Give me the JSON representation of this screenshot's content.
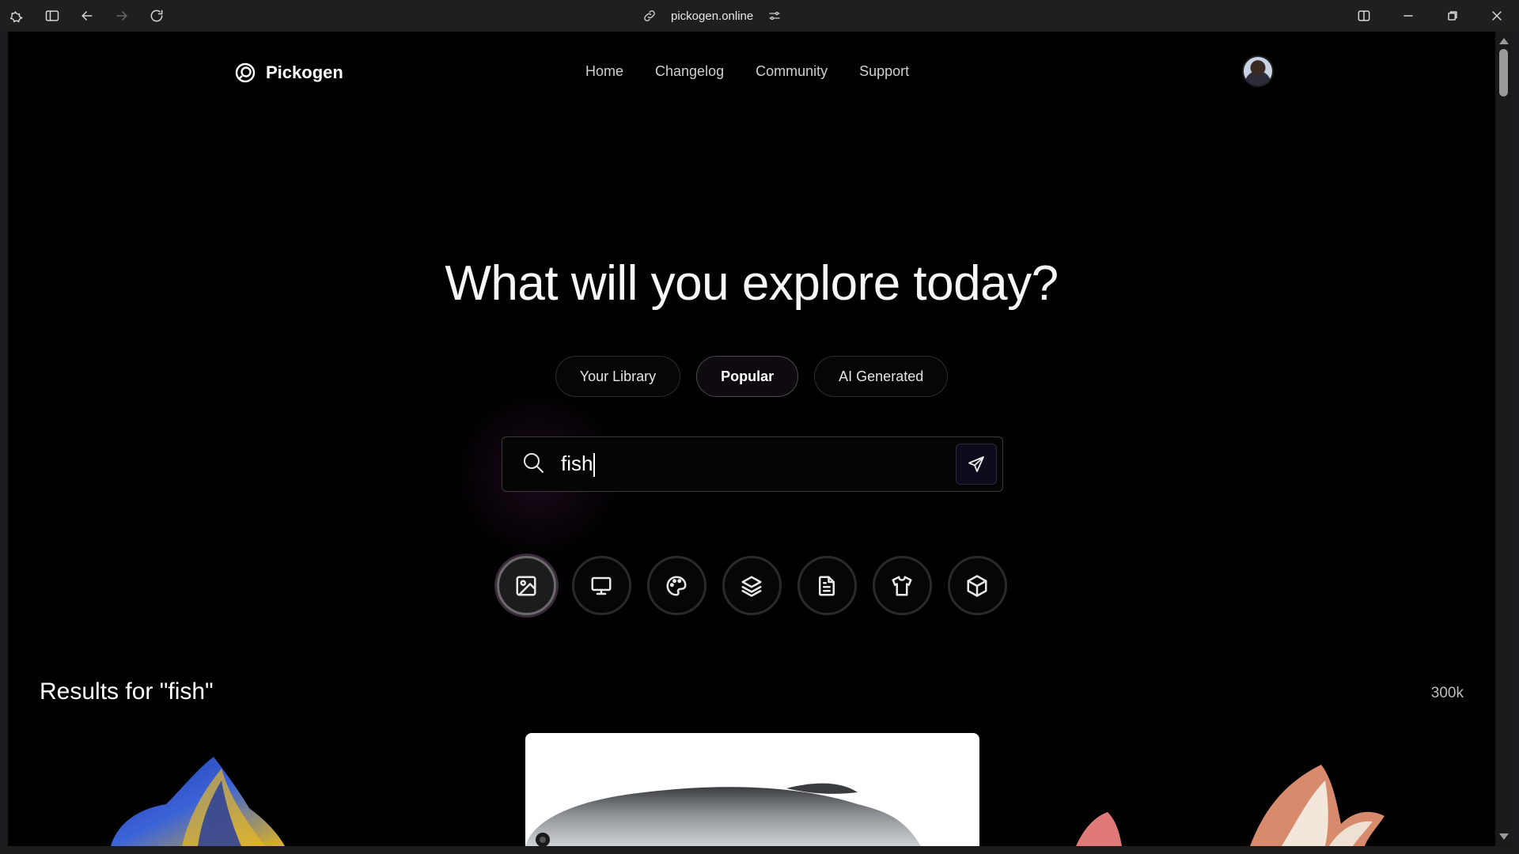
{
  "browser": {
    "url": "pickogen.online"
  },
  "site": {
    "brand": "Pickogen",
    "nav": [
      "Home",
      "Changelog",
      "Community",
      "Support"
    ]
  },
  "hero": {
    "title": "What will you explore today?",
    "pills": [
      "Your Library",
      "Popular",
      "AI Generated"
    ],
    "active_pill": "Popular"
  },
  "search": {
    "value": "fish"
  },
  "categories": [
    "image-icon",
    "monitor-icon",
    "palette-icon",
    "layers-icon",
    "document-icon",
    "shirt-icon",
    "box-icon"
  ],
  "results": {
    "title": "Results for \"fish\"",
    "count": "300k"
  },
  "colors": {
    "background": "#000000",
    "accent_glow": "#6e286e",
    "chrome": "#1f1f21"
  }
}
